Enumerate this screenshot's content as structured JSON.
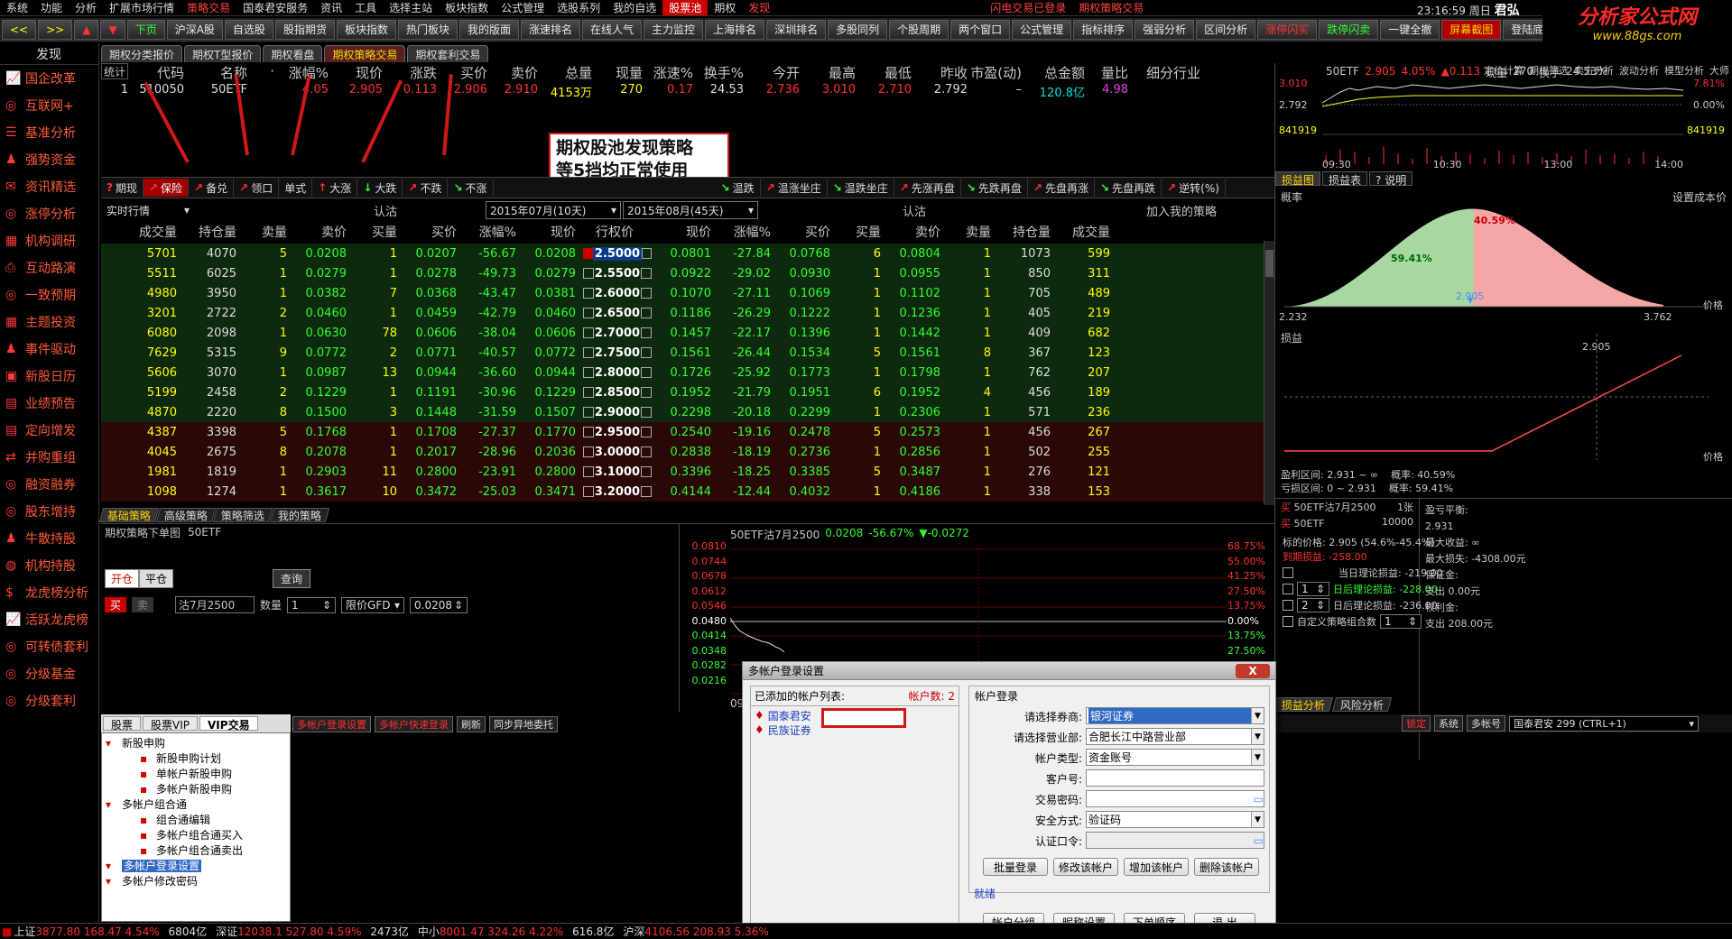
{
  "menubar": {
    "items": [
      "系统",
      "功能",
      "分析",
      "扩展市场行情",
      "策略交易",
      "国泰君安服务",
      "资讯",
      "工具",
      "选择主站",
      "板块指数",
      "公式管理",
      "选股系列",
      "我的自选",
      "股票池",
      "期权",
      "发现"
    ],
    "right": [
      "闪电交易已登录",
      "期权策略交易"
    ],
    "time": "23:16:59",
    "weekday": "周日",
    "brand": "君弘",
    "right2": [
      "行情",
      "资讯"
    ]
  },
  "toolbar": {
    "buttons": [
      "<<",
      ">>",
      "▲",
      "▼",
      "下页",
      "沪深A股",
      "自选股",
      "股指期货",
      "板块指数",
      "热门板块",
      "我的版面",
      "涨速排名",
      "在线人气",
      "主力监控",
      "上海排名",
      "深圳排名",
      "多股同列",
      "个股周期",
      "两个窗口",
      "公式管理",
      "指标排序",
      "强弱分析",
      "区间分析",
      "涨停闪买",
      "跌停闪卖",
      "一键全撤",
      "屏幕截图",
      "登陆底栏"
    ]
  },
  "logo": {
    "title": "分析家公式网",
    "url": "www.88gs.com"
  },
  "sidebar": {
    "header": "发现",
    "items": [
      {
        "label": "国企改革",
        "icon": "chart-icon"
      },
      {
        "label": "互联网+",
        "icon": "cycle-icon"
      },
      {
        "label": "基准分析",
        "icon": "list-icon"
      },
      {
        "label": "强势资金",
        "icon": "person-icon"
      },
      {
        "label": "资讯精选",
        "icon": "mail-icon"
      },
      {
        "label": "涨停分析",
        "icon": "cycle-icon"
      },
      {
        "label": "机构调研",
        "icon": "grid-icon"
      },
      {
        "label": "互动路演",
        "icon": "print-icon"
      },
      {
        "label": "一致预期",
        "icon": "cycle-icon"
      },
      {
        "label": "主题投资",
        "icon": "grid-icon"
      },
      {
        "label": "事件驱动",
        "icon": "person-icon"
      },
      {
        "label": "新股日历",
        "icon": "calendar-icon"
      },
      {
        "label": "业绩预告",
        "icon": "doc-icon"
      },
      {
        "label": "定向增发",
        "icon": "doc-icon"
      },
      {
        "label": "并购重组",
        "icon": "merge-icon"
      },
      {
        "label": "融资融券",
        "icon": "cycle-icon"
      },
      {
        "label": "股东增持",
        "icon": "cycle-icon"
      },
      {
        "label": "牛散持股",
        "icon": "person-icon"
      },
      {
        "label": "机构持股",
        "icon": "globe-icon"
      },
      {
        "label": "龙虎榜分析",
        "icon": "dollar-icon"
      },
      {
        "label": "活跃龙虎榜",
        "icon": "chart-icon"
      },
      {
        "label": "可转债套利",
        "icon": "cycle-icon"
      },
      {
        "label": "分级基金",
        "icon": "cycle-icon"
      },
      {
        "label": "分级套利",
        "icon": "cycle-icon"
      }
    ]
  },
  "tabs1": [
    {
      "label": "期权分类报价",
      "active": false
    },
    {
      "label": "期权T型报价",
      "active": false
    },
    {
      "label": "期权看盘",
      "active": false
    },
    {
      "label": "期权策略交易",
      "active": true
    },
    {
      "label": "期权套利交易",
      "active": false
    }
  ],
  "quote": {
    "headers": [
      "统计",
      "代码",
      "名称",
      "·",
      "涨幅%",
      "现价",
      "涨跌",
      "买价",
      "卖价",
      "总量",
      "现量",
      "涨速%",
      "换手%",
      "今开",
      "最高",
      "最低",
      "昨收",
      "市盈(动)",
      "总金额",
      "量比",
      "细分行业"
    ],
    "row": [
      "1",
      "510050",
      "50ETF",
      "",
      "4.05",
      "2.905",
      "0.113",
      "2.906",
      "2.910",
      "4153万",
      "270",
      "0.17",
      "24.53",
      "2.736",
      "3.010",
      "2.710",
      "2.792",
      "–",
      "120.8亿",
      "4.98",
      ""
    ]
  },
  "annotation": {
    "line1": "期权股池发现策略",
    "line2": "等5挡均正常使用"
  },
  "strategies": [
    {
      "label": "期现",
      "active": false
    },
    {
      "label": "保险",
      "active": true
    },
    {
      "label": "备兑",
      "active": false
    },
    {
      "label": "领口",
      "active": false
    },
    {
      "label": "单式",
      "active": false
    },
    {
      "label": "大涨",
      "active": false
    },
    {
      "label": "大跌",
      "active": false
    },
    {
      "label": "不跌",
      "active": false
    },
    {
      "label": "不涨",
      "active": false
    },
    {
      "label": "温跌",
      "active": false
    },
    {
      "label": "温涨坐庄",
      "active": false
    },
    {
      "label": "温跌坐庄",
      "active": false
    },
    {
      "label": "先涨再盘",
      "active": false
    },
    {
      "label": "先跌再盘",
      "active": false
    },
    {
      "label": "先盘再涨",
      "active": false
    },
    {
      "label": "先盘再跌",
      "active": false
    },
    {
      "label": "逆转(%)",
      "active": false
    }
  ],
  "filter": {
    "realtime": "实时行情",
    "left_label": "认沽",
    "month1": "2015年07月(10天)",
    "month2": "2015年08月(45天)",
    "right_label": "认沽",
    "add": "加入我的策略"
  },
  "tquote": {
    "headers": [
      "成交量",
      "持仓量",
      "卖量",
      "卖价",
      "买量",
      "买价",
      "涨幅%",
      "现价",
      "行权价",
      "现价",
      "涨幅%",
      "买价",
      "买量",
      "卖价",
      "卖量",
      "持仓量",
      "成交量"
    ],
    "rows": [
      [
        "5701",
        "4070",
        "5",
        "0.0208",
        "1",
        "0.0207",
        "-56.67",
        "0.0208",
        "2.5000",
        "0.0801",
        "-27.84",
        "0.0768",
        "6",
        "0.0804",
        "1",
        "1073",
        "599"
      ],
      [
        "5511",
        "6025",
        "1",
        "0.0279",
        "1",
        "0.0278",
        "-49.73",
        "0.0279",
        "2.5500",
        "0.0922",
        "-29.02",
        "0.0930",
        "1",
        "0.0955",
        "1",
        "850",
        "311"
      ],
      [
        "4980",
        "3950",
        "1",
        "0.0382",
        "7",
        "0.0368",
        "-43.47",
        "0.0381",
        "2.6000",
        "0.1070",
        "-27.11",
        "0.1069",
        "1",
        "0.1102",
        "1",
        "705",
        "489"
      ],
      [
        "3201",
        "2722",
        "2",
        "0.0460",
        "1",
        "0.0459",
        "-42.79",
        "0.0460",
        "2.6500",
        "0.1186",
        "-26.29",
        "0.1222",
        "1",
        "0.1236",
        "1",
        "405",
        "219"
      ],
      [
        "6080",
        "2098",
        "1",
        "0.0630",
        "78",
        "0.0606",
        "-38.04",
        "0.0606",
        "2.7000",
        "0.1457",
        "-22.17",
        "0.1396",
        "1",
        "0.1442",
        "1",
        "409",
        "682"
      ],
      [
        "7629",
        "5315",
        "9",
        "0.0772",
        "2",
        "0.0771",
        "-40.57",
        "0.0772",
        "2.7500",
        "0.1561",
        "-26.44",
        "0.1534",
        "5",
        "0.1561",
        "8",
        "367",
        "123"
      ],
      [
        "5606",
        "3070",
        "1",
        "0.0987",
        "13",
        "0.0944",
        "-36.60",
        "0.0944",
        "2.8000",
        "0.1726",
        "-25.92",
        "0.1773",
        "1",
        "0.1798",
        "1",
        "762",
        "207"
      ],
      [
        "5199",
        "2458",
        "2",
        "0.1229",
        "1",
        "0.1191",
        "-30.96",
        "0.1229",
        "2.8500",
        "0.1952",
        "-21.79",
        "0.1951",
        "6",
        "0.1952",
        "4",
        "456",
        "189"
      ],
      [
        "4870",
        "2220",
        "8",
        "0.1500",
        "3",
        "0.1448",
        "-31.59",
        "0.1507",
        "2.9000",
        "0.2298",
        "-20.18",
        "0.2299",
        "1",
        "0.2306",
        "1",
        "571",
        "236"
      ],
      [
        "4387",
        "3398",
        "5",
        "0.1768",
        "1",
        "0.1708",
        "-27.37",
        "0.1770",
        "2.9500",
        "0.2540",
        "-19.16",
        "0.2478",
        "5",
        "0.2573",
        "1",
        "456",
        "267"
      ],
      [
        "4045",
        "2675",
        "8",
        "0.2078",
        "1",
        "0.2017",
        "-28.96",
        "0.2036",
        "3.0000",
        "0.2838",
        "-18.19",
        "0.2736",
        "1",
        "0.2856",
        "1",
        "502",
        "255"
      ],
      [
        "1981",
        "1819",
        "1",
        "0.2903",
        "11",
        "0.2800",
        "-23.91",
        "0.2800",
        "3.1000",
        "0.3396",
        "-18.25",
        "0.3385",
        "5",
        "0.3487",
        "1",
        "276",
        "121"
      ],
      [
        "1098",
        "1274",
        "1",
        "0.3617",
        "10",
        "0.3472",
        "-25.03",
        "0.3471",
        "3.2000",
        "0.4144",
        "-12.44",
        "0.4032",
        "1",
        "0.4186",
        "1",
        "338",
        "153"
      ]
    ]
  },
  "bottomtabs": [
    {
      "label": "基础策略",
      "active": true
    },
    {
      "label": "高级策略",
      "active": false
    },
    {
      "label": "策略筛选",
      "active": false
    },
    {
      "label": "我的策略",
      "active": false
    }
  ],
  "order": {
    "title": "期权策略下单图",
    "code": "50ETF",
    "open": "开仓",
    "close": "平仓",
    "query": "查询",
    "buy": "买",
    "sell": "卖",
    "contract": "沽7月2500",
    "qty_label": "数量",
    "qty": "1",
    "price_type": "限价GFD",
    "price": "0.0208"
  },
  "minichart": {
    "title": "50ETF沽7月2500",
    "price": "0.0208",
    "pct": "-56.67%",
    "chg": "▼-0.0272",
    "left_axis": [
      "0.0810",
      "0.0744",
      "0.0678",
      "0.0612",
      "0.0546",
      "0.0480",
      "0.0414",
      "0.0348",
      "0.0282",
      "0.0216"
    ],
    "right_axis": [
      "68.75%",
      "55.00%",
      "41.25%",
      "27.50%",
      "13.75%",
      "0.00%",
      "13.75%",
      "27.50%",
      "41.25%",
      "55.00%"
    ],
    "time": "09:30"
  },
  "tree": {
    "tabs": [
      "股票",
      "股票VIP",
      "VIP交易"
    ],
    "items": [
      {
        "label": "新股申购",
        "level": 0
      },
      {
        "label": "新股申购计划",
        "level": 1
      },
      {
        "label": "单帐户新股申购",
        "level": 1
      },
      {
        "label": "多帐户新股申购",
        "level": 1
      },
      {
        "label": "多帐户组合通",
        "level": 0
      },
      {
        "label": "组合通编辑",
        "level": 1
      },
      {
        "label": "多帐户组合通买入",
        "level": 1
      },
      {
        "label": "多帐户组合通卖出",
        "level": 1
      },
      {
        "label": "多帐户登录设置",
        "level": 0,
        "selected": true
      },
      {
        "label": "多帐户修改密码",
        "level": 0
      }
    ]
  },
  "tradetoolbar": [
    "多帐户登录设置",
    "多帐户快速登录",
    "刷新",
    "同步异地委托"
  ],
  "rightchart": {
    "code": "50ETF",
    "price": "2.905",
    "pct": "4.05%",
    "chg": "▲0.113",
    "volume_label": "现量",
    "volume": "270",
    "turnover_label": "换手",
    "turnover": "24.53%",
    "y_top": "3.010",
    "y_mid": "2.792",
    "y_low": "841919",
    "r_top": "7.81%",
    "r_mid": "0.00%",
    "r_low": "841919",
    "times": [
      "09:30",
      "10:30",
      "13:00",
      "14:00"
    ],
    "top_right": [
      "定价计算",
      "期权筛选",
      "卖方分析",
      "波动分析",
      "模型分析",
      "大师"
    ]
  },
  "profit": {
    "tabs": [
      "损益图",
      "损益表",
      "? 说明"
    ],
    "prob_label": "概率",
    "setting": "设置成本价",
    "pct_left": "59.41%",
    "pct_right": "40.59%",
    "strike": "2.905",
    "x_min": "2.232",
    "x_max": "3.762",
    "price_axis": "价格",
    "pl_label": "损益",
    "pl_point": "2.905",
    "profit_range": "盈利区间: 2.931 ~ ∞",
    "profit_prob": "概率: 40.59%",
    "loss_range": "亏损区间: 0 ~ 2.931",
    "loss_prob": "概率: 59.41%"
  },
  "position": {
    "legs": [
      {
        "side": "买",
        "name": "50ETF沽7月2500",
        "qty": "1张"
      },
      {
        "side": "买",
        "name": "50ETF",
        "qty": "10000"
      }
    ],
    "target_price": "标的价格: 2.905 (54.6%-45.4%)",
    "expire_pl": "到期损益: -258.00",
    "today_pl": "当日理论损益: -219.00",
    "after1": "日后理论损益: -228.00",
    "after1_n": "1",
    "after2": "日后理论损益: -236.00",
    "after2_n": "2",
    "custom": "自定义策略组合数",
    "custom_n": "1",
    "breakeven": "盈亏平衡:",
    "breakeven_v": "2.931",
    "max_gain": "最大收益: ∞",
    "max_loss": "最大损失: -4308.00元",
    "margin": "保证金:",
    "expense": "支出 0.00元",
    "premium": "权利金:",
    "expense2": "支出 208.00元"
  },
  "bottomtabs2": [
    "损益分析",
    "风险分析"
  ],
  "tradebar": {
    "buttons": [
      "锁定",
      "系统",
      "多帐号"
    ],
    "account": "国泰君安 299 (CTRL+1)"
  },
  "dialog": {
    "title": "多帐户登录设置",
    "close": "X",
    "list_title": "已添加的帐户列表:",
    "account_count": "帐户数: 2",
    "accounts": [
      "国泰君安",
      "民族证券"
    ],
    "login_title": "帐户登录",
    "labels": [
      "请选择券商:",
      "请选择营业部:",
      "帐户类型:",
      "客户号:",
      "交易密码:",
      "安全方式:",
      "认证口令:"
    ],
    "broker": "银河证券",
    "branch": "合肥长江中路营业部",
    "acct_type": "资金账号",
    "security": "验证码",
    "btns1": [
      "批量登录",
      "修改该帐户",
      "增加该帐户",
      "删除该帐户"
    ],
    "status": "就绪",
    "btns2": [
      "帐户分组",
      "昵称设置",
      "下单顺序",
      "退 出"
    ]
  },
  "status": {
    "items": [
      {
        "label": "上证",
        "value": "3877.80",
        "chg": "168.47",
        "pct": "4.54%",
        "vol": "6804亿"
      },
      {
        "label": "深证",
        "value": "12038.1",
        "chg": "527.80",
        "pct": "4.59%",
        "vol": "2473亿"
      },
      {
        "label": "中小",
        "value": "8001.47",
        "chg": "324.26",
        "pct": "4.22%",
        "vol": "616.8亿"
      },
      {
        "label": "沪深",
        "value": "4106.56",
        "chg": "208.93",
        "pct": "5.36%",
        "vol": ""
      }
    ]
  },
  "colors": {
    "red": "#ff3030",
    "green": "#30ff30",
    "yellow": "#ffff00",
    "cyan": "#00e0e0",
    "blue": "#4a8cff",
    "call_row": "#0e2a0e",
    "put_row": "#2a0808"
  }
}
